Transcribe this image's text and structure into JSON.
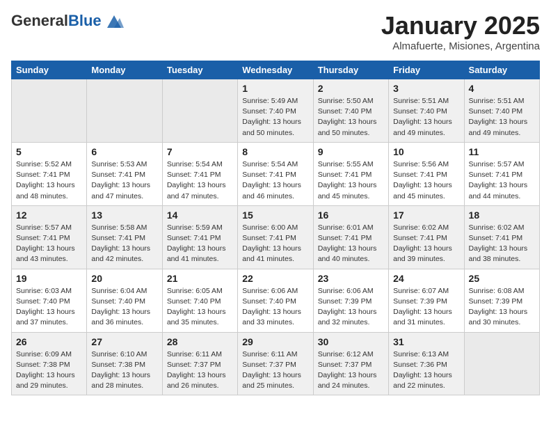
{
  "header": {
    "logo_general": "General",
    "logo_blue": "Blue",
    "month_title": "January 2025",
    "subtitle": "Almafuerte, Misiones, Argentina"
  },
  "weekdays": [
    "Sunday",
    "Monday",
    "Tuesday",
    "Wednesday",
    "Thursday",
    "Friday",
    "Saturday"
  ],
  "weeks": [
    [
      {
        "day": "",
        "info": ""
      },
      {
        "day": "",
        "info": ""
      },
      {
        "day": "",
        "info": ""
      },
      {
        "day": "1",
        "info": "Sunrise: 5:49 AM\nSunset: 7:40 PM\nDaylight: 13 hours\nand 50 minutes."
      },
      {
        "day": "2",
        "info": "Sunrise: 5:50 AM\nSunset: 7:40 PM\nDaylight: 13 hours\nand 50 minutes."
      },
      {
        "day": "3",
        "info": "Sunrise: 5:51 AM\nSunset: 7:40 PM\nDaylight: 13 hours\nand 49 minutes."
      },
      {
        "day": "4",
        "info": "Sunrise: 5:51 AM\nSunset: 7:40 PM\nDaylight: 13 hours\nand 49 minutes."
      }
    ],
    [
      {
        "day": "5",
        "info": "Sunrise: 5:52 AM\nSunset: 7:41 PM\nDaylight: 13 hours\nand 48 minutes."
      },
      {
        "day": "6",
        "info": "Sunrise: 5:53 AM\nSunset: 7:41 PM\nDaylight: 13 hours\nand 47 minutes."
      },
      {
        "day": "7",
        "info": "Sunrise: 5:54 AM\nSunset: 7:41 PM\nDaylight: 13 hours\nand 47 minutes."
      },
      {
        "day": "8",
        "info": "Sunrise: 5:54 AM\nSunset: 7:41 PM\nDaylight: 13 hours\nand 46 minutes."
      },
      {
        "day": "9",
        "info": "Sunrise: 5:55 AM\nSunset: 7:41 PM\nDaylight: 13 hours\nand 45 minutes."
      },
      {
        "day": "10",
        "info": "Sunrise: 5:56 AM\nSunset: 7:41 PM\nDaylight: 13 hours\nand 45 minutes."
      },
      {
        "day": "11",
        "info": "Sunrise: 5:57 AM\nSunset: 7:41 PM\nDaylight: 13 hours\nand 44 minutes."
      }
    ],
    [
      {
        "day": "12",
        "info": "Sunrise: 5:57 AM\nSunset: 7:41 PM\nDaylight: 13 hours\nand 43 minutes."
      },
      {
        "day": "13",
        "info": "Sunrise: 5:58 AM\nSunset: 7:41 PM\nDaylight: 13 hours\nand 42 minutes."
      },
      {
        "day": "14",
        "info": "Sunrise: 5:59 AM\nSunset: 7:41 PM\nDaylight: 13 hours\nand 41 minutes."
      },
      {
        "day": "15",
        "info": "Sunrise: 6:00 AM\nSunset: 7:41 PM\nDaylight: 13 hours\nand 41 minutes."
      },
      {
        "day": "16",
        "info": "Sunrise: 6:01 AM\nSunset: 7:41 PM\nDaylight: 13 hours\nand 40 minutes."
      },
      {
        "day": "17",
        "info": "Sunrise: 6:02 AM\nSunset: 7:41 PM\nDaylight: 13 hours\nand 39 minutes."
      },
      {
        "day": "18",
        "info": "Sunrise: 6:02 AM\nSunset: 7:41 PM\nDaylight: 13 hours\nand 38 minutes."
      }
    ],
    [
      {
        "day": "19",
        "info": "Sunrise: 6:03 AM\nSunset: 7:40 PM\nDaylight: 13 hours\nand 37 minutes."
      },
      {
        "day": "20",
        "info": "Sunrise: 6:04 AM\nSunset: 7:40 PM\nDaylight: 13 hours\nand 36 minutes."
      },
      {
        "day": "21",
        "info": "Sunrise: 6:05 AM\nSunset: 7:40 PM\nDaylight: 13 hours\nand 35 minutes."
      },
      {
        "day": "22",
        "info": "Sunrise: 6:06 AM\nSunset: 7:40 PM\nDaylight: 13 hours\nand 33 minutes."
      },
      {
        "day": "23",
        "info": "Sunrise: 6:06 AM\nSunset: 7:39 PM\nDaylight: 13 hours\nand 32 minutes."
      },
      {
        "day": "24",
        "info": "Sunrise: 6:07 AM\nSunset: 7:39 PM\nDaylight: 13 hours\nand 31 minutes."
      },
      {
        "day": "25",
        "info": "Sunrise: 6:08 AM\nSunset: 7:39 PM\nDaylight: 13 hours\nand 30 minutes."
      }
    ],
    [
      {
        "day": "26",
        "info": "Sunrise: 6:09 AM\nSunset: 7:38 PM\nDaylight: 13 hours\nand 29 minutes."
      },
      {
        "day": "27",
        "info": "Sunrise: 6:10 AM\nSunset: 7:38 PM\nDaylight: 13 hours\nand 28 minutes."
      },
      {
        "day": "28",
        "info": "Sunrise: 6:11 AM\nSunset: 7:37 PM\nDaylight: 13 hours\nand 26 minutes."
      },
      {
        "day": "29",
        "info": "Sunrise: 6:11 AM\nSunset: 7:37 PM\nDaylight: 13 hours\nand 25 minutes."
      },
      {
        "day": "30",
        "info": "Sunrise: 6:12 AM\nSunset: 7:37 PM\nDaylight: 13 hours\nand 24 minutes."
      },
      {
        "day": "31",
        "info": "Sunrise: 6:13 AM\nSunset: 7:36 PM\nDaylight: 13 hours\nand 22 minutes."
      },
      {
        "day": "",
        "info": ""
      }
    ]
  ]
}
